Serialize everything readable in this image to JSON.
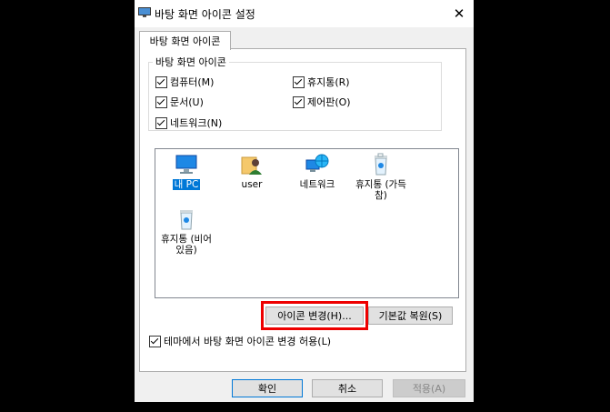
{
  "window": {
    "title": "바탕 화면 아이콘 설정",
    "close_glyph": "✕"
  },
  "tab": {
    "label": "바탕 화면 아이콘"
  },
  "group": {
    "legend": "바탕 화면 아이콘",
    "checkboxes": [
      {
        "label": "컴퓨터(M)",
        "checked": true
      },
      {
        "label": "휴지통(R)",
        "checked": true
      },
      {
        "label": "문서(U)",
        "checked": true
      },
      {
        "label": "제어판(O)",
        "checked": true
      },
      {
        "label": "네트워크(N)",
        "checked": true
      }
    ]
  },
  "icons": [
    {
      "label": "내 PC",
      "icon": "monitor-icon",
      "selected": true
    },
    {
      "label": "user",
      "icon": "user-folder-icon",
      "selected": false
    },
    {
      "label": "네트워크",
      "icon": "network-globe-icon",
      "selected": false
    },
    {
      "label": "휴지통 (가득 참)",
      "label_lines": [
        "휴지통 (가득",
        "참)"
      ],
      "icon": "recycle-bin-full-icon",
      "selected": false
    },
    {
      "label": "휴지통 (비어 있음)",
      "label_lines": [
        "휴지통 (비어",
        "있음)"
      ],
      "icon": "recycle-bin-empty-icon",
      "selected": false
    }
  ],
  "buttons": {
    "change_icon": "아이콘 변경(H)...",
    "restore_default": "기본값 복원(S)",
    "ok": "확인",
    "cancel": "취소",
    "apply": "적용(A)"
  },
  "theme_checkbox": {
    "label": "테마에서 바탕 화면 아이콘 변경 허용(L)",
    "checked": true
  },
  "colors": {
    "selection": "#0078d7",
    "highlight_box": "#e00000"
  }
}
